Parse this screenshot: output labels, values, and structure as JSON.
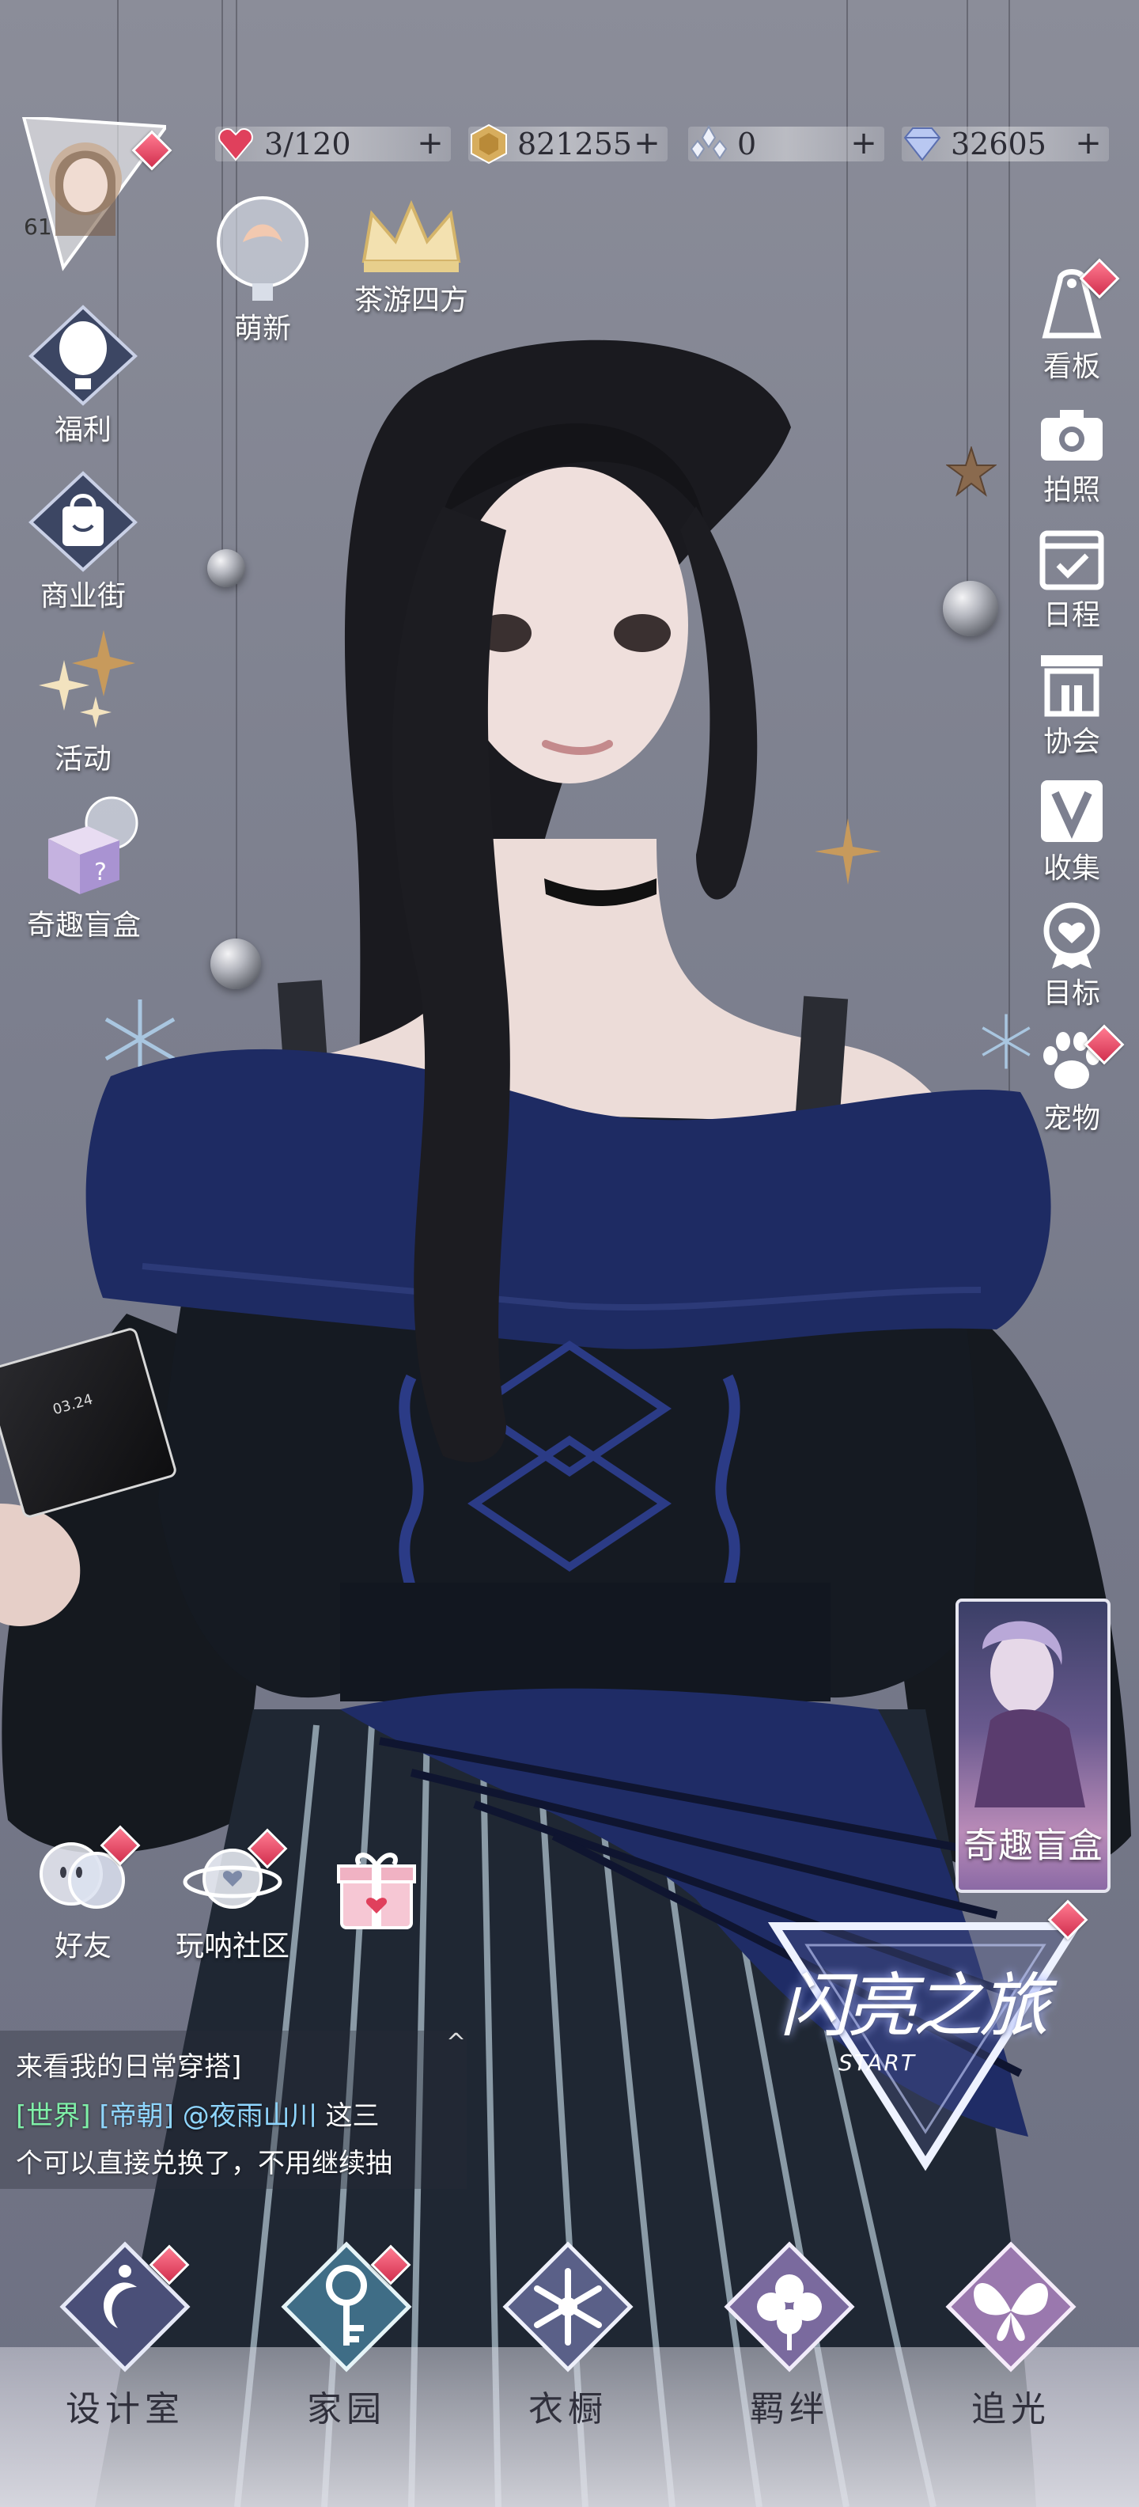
{
  "player": {
    "level": "61"
  },
  "resources": [
    {
      "name": "stamina",
      "icon": "heart-gem-icon",
      "value": "3/120"
    },
    {
      "name": "gold",
      "icon": "gold-coin-icon",
      "value": "821255"
    },
    {
      "name": "crystal",
      "icon": "crystal-cluster-icon",
      "value": "0"
    },
    {
      "name": "diamond",
      "icon": "diamond-icon",
      "value": "32605"
    }
  ],
  "top_events": [
    {
      "label": "萌新",
      "icon": "crystal-ball-icon"
    },
    {
      "label": "茶游四方",
      "icon": "crown-icon"
    }
  ],
  "left_menu": [
    {
      "label": "福利",
      "icon": "hot-air-balloon-icon"
    },
    {
      "label": "商业街",
      "icon": "shopping-bag-icon"
    },
    {
      "label": "活动",
      "icon": "stars-icon"
    },
    {
      "label": "奇趣盲盒",
      "icon": "gift-box-icon"
    }
  ],
  "right_menu": [
    {
      "label": "看板",
      "icon": "dress-board-icon"
    },
    {
      "label": "拍照",
      "icon": "camera-icon"
    },
    {
      "label": "日程",
      "icon": "calendar-check-icon"
    },
    {
      "label": "协会",
      "icon": "guild-building-icon"
    },
    {
      "label": "收集",
      "icon": "collection-v-icon"
    },
    {
      "label": "目标",
      "icon": "heart-medal-icon"
    },
    {
      "label": "宠物",
      "icon": "paw-icon"
    }
  ],
  "held_card": {
    "text": "03.24"
  },
  "promo_card": {
    "label": "奇趣盲盒"
  },
  "social": [
    {
      "label": "好友",
      "icon": "friends-icon"
    },
    {
      "label": "玩呐社区",
      "icon": "planet-heart-icon"
    }
  ],
  "start_button": {
    "title": "闪亮之旅",
    "subtitle": "START"
  },
  "chat": {
    "line1": "来看我的日常穿搭]",
    "channel": "[世界]",
    "guild": "[帝朝]",
    "mention": "@夜雨山川",
    "line2_rest": " 这三",
    "line3": "个可以直接兑换了，不用继续抽"
  },
  "bottom_nav": [
    {
      "label": "设计室",
      "icon": "moon-pendant-icon"
    },
    {
      "label": "家园",
      "icon": "key-icon"
    },
    {
      "label": "衣橱",
      "icon": "snowflake-gem-icon"
    },
    {
      "label": "羁绊",
      "icon": "clover-icon"
    },
    {
      "label": "追光",
      "icon": "butterfly-icon"
    }
  ],
  "colors": {
    "accent_red": "#e0405c",
    "nav_text": "#30303c",
    "sweater_blue": "#1e2b63",
    "skirt_stripe": "#8a9aa6"
  }
}
